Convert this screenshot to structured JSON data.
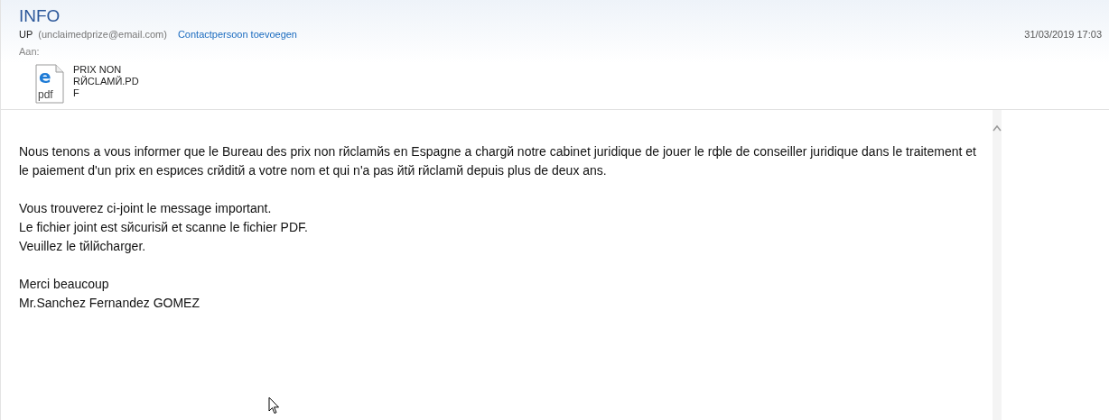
{
  "message": {
    "subject": "INFO",
    "sender_name": "UP",
    "sender_email": "(unclaimedprize@email.com)",
    "add_contact": "Contactpersoon toevoegen",
    "date": "31/03/2019 17:03",
    "to_label": "Aan:"
  },
  "attachment": {
    "icon_letter": "e",
    "icon_type": "pdf",
    "lines": [
      "PRIX NON",
      "RЙCLAMЙ.PD",
      "F"
    ]
  },
  "body": [
    [
      "Nous tenons a vous informer que le Bureau des prix non rйclamйs en Espagne a chargй notre cabinet juridique de jouer le rфle de conseiller juridique dans le traitement et le paiement d'un prix en espиces crйditй a votre nom et qui n'a pas йtй rйclamй depuis plus de deux ans."
    ],
    [
      "Vous trouverez ci-joint le message important.",
      "Le fichier joint est sйcurisй et scanne le fichier PDF.",
      "Veuillez le tйlйcharger."
    ],
    [
      "Merci beaucoup",
      "Mr.Sanchez Fernandez GOMEZ"
    ]
  ]
}
